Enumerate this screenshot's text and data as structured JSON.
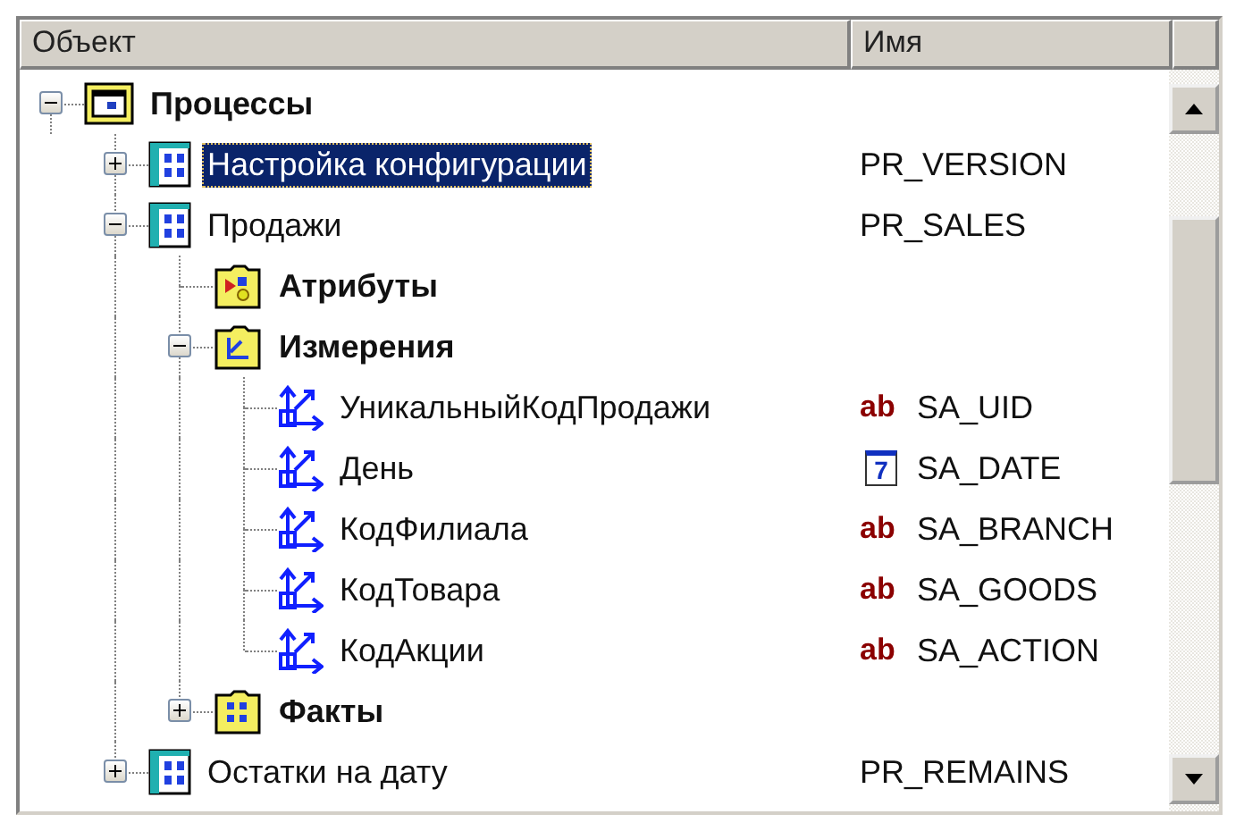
{
  "columns": [
    {
      "label": "Объект"
    },
    {
      "label": "Имя"
    }
  ],
  "tree": [
    {
      "label": "Процессы",
      "bold": true,
      "kind": "process",
      "expanded": true,
      "selected": false,
      "children": [
        {
          "label": "Настройка конфигурации",
          "bold": false,
          "kind": "table",
          "expanded": false,
          "selected": true,
          "name": "PR_VERSION"
        },
        {
          "label": "Продажи",
          "bold": false,
          "kind": "table",
          "expanded": true,
          "selected": false,
          "name": "PR_SALES",
          "children": [
            {
              "label": "Атрибуты",
              "bold": true,
              "kind": "attr-folder",
              "selected": false
            },
            {
              "label": "Измерения",
              "bold": true,
              "kind": "dim-folder",
              "expanded": true,
              "selected": false,
              "children": [
                {
                  "label": "УникальныйКодПродажи",
                  "bold": false,
                  "kind": "dimension",
                  "selected": false,
                  "name": "SA_UID",
                  "type": {
                    "kind": "string",
                    "glyph": "ab"
                  }
                },
                {
                  "label": "День",
                  "bold": false,
                  "kind": "dimension",
                  "selected": false,
                  "name": "SA_DATE",
                  "type": {
                    "kind": "date",
                    "glyph": "7"
                  }
                },
                {
                  "label": "КодФилиала",
                  "bold": false,
                  "kind": "dimension",
                  "selected": false,
                  "name": "SA_BRANCH",
                  "type": {
                    "kind": "string",
                    "glyph": "ab"
                  }
                },
                {
                  "label": "КодТовара",
                  "bold": false,
                  "kind": "dimension",
                  "selected": false,
                  "name": "SA_GOODS",
                  "type": {
                    "kind": "string",
                    "glyph": "ab"
                  }
                },
                {
                  "label": "КодАкции",
                  "bold": false,
                  "kind": "dimension",
                  "selected": false,
                  "name": "SA_ACTION",
                  "type": {
                    "kind": "string",
                    "glyph": "ab"
                  }
                }
              ]
            },
            {
              "label": "Факты",
              "bold": true,
              "kind": "fact-folder",
              "expanded": false,
              "selected": false
            }
          ]
        },
        {
          "label": "Остатки на дату",
          "bold": false,
          "kind": "table",
          "expanded": false,
          "selected": false,
          "name": "PR_REMAINS"
        }
      ]
    }
  ]
}
